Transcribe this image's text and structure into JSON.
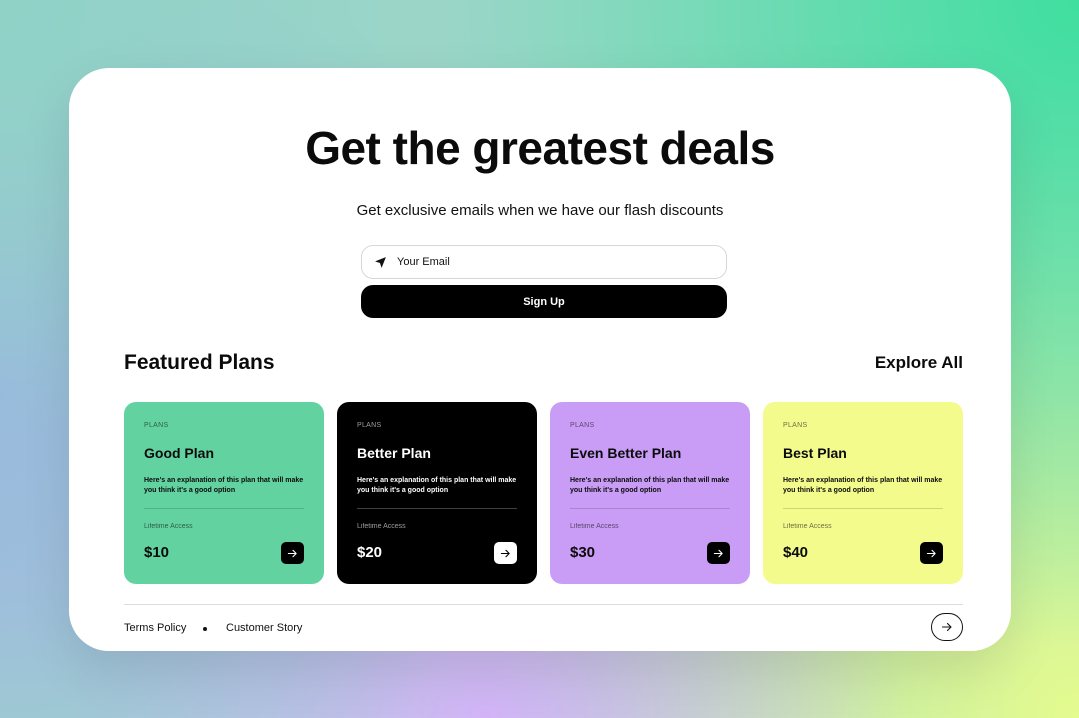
{
  "hero": {
    "title": "Get the greatest deals",
    "subtitle": "Get exclusive emails when we have our flash discounts"
  },
  "signup_form": {
    "email_placeholder": "Your Email",
    "email_icon": "send-icon",
    "button_label": "Sign Up"
  },
  "featured": {
    "title": "Featured Plans",
    "explore_label": "Explore All"
  },
  "plans": [
    {
      "eyebrow": "PLANS",
      "name": "Good Plan",
      "description": "Here's an explanation of this plan that will make you think it's a good option",
      "access": "Lifetime Access",
      "price": "$10",
      "bg": "#62d3a0",
      "fg": "#0b0b0b"
    },
    {
      "eyebrow": "PLANS",
      "name": "Better Plan",
      "description": "Here's an explanation of this plan that will make you think it's a good option",
      "access": "Lifetime Access",
      "price": "$20",
      "bg": "#000000",
      "fg": "#ffffff"
    },
    {
      "eyebrow": "PLANS",
      "name": "Even Better Plan",
      "description": "Here's an explanation of this plan that will make you think it's a good option",
      "access": "Lifetime Access",
      "price": "$30",
      "bg": "#c99cf6",
      "fg": "#0b0b0b"
    },
    {
      "eyebrow": "PLANS",
      "name": "Best Plan",
      "description": "Here's an explanation of this plan that will make you think it's a good option",
      "access": "Lifetime Access",
      "price": "$40",
      "bg": "#f3fb8c",
      "fg": "#0b0b0b"
    }
  ],
  "footer": {
    "links": [
      "Terms Policy",
      "Customer Story"
    ],
    "arrow_icon": "arrow-right-icon"
  }
}
